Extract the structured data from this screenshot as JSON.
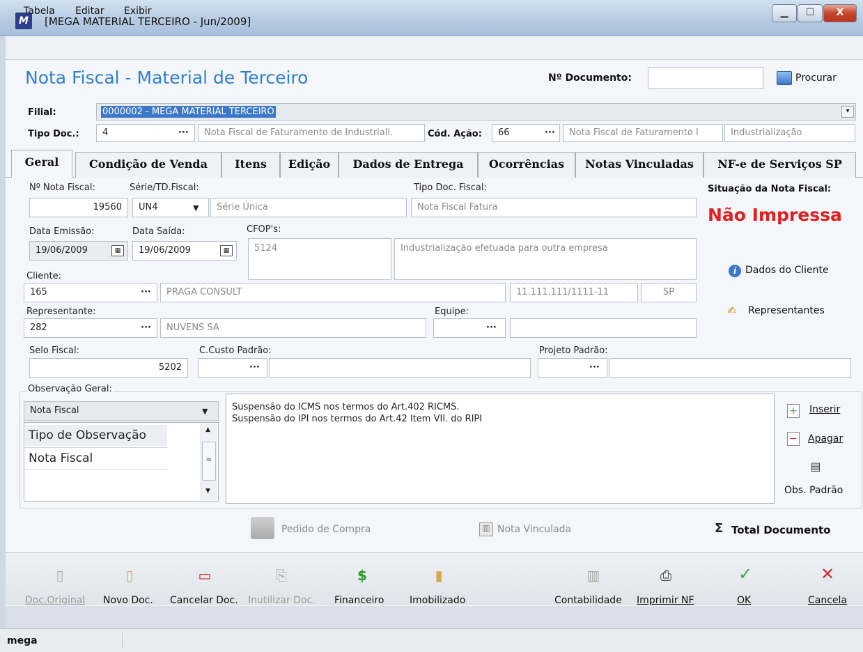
{
  "window": {
    "title": "[MEGA MATERIAL TERCEIRO - Jun/2009]",
    "controls": {
      "minimize": "▁",
      "maximize": "☐",
      "close": "X"
    }
  },
  "menu": [
    "Tabela",
    "Editar",
    "Exibir"
  ],
  "header": {
    "title": "Nota Fiscal - Material de Terceiro",
    "doc_label": "Nº Documento:",
    "doc_value": "",
    "search_label": "Procurar"
  },
  "filial": {
    "label": "Filial:",
    "value": "0000002 - MEGA MATERIAL TERCEIRO"
  },
  "tipo_doc": {
    "label": "Tipo Doc.:",
    "code": "4",
    "desc": "Nota Fiscal de Faturamento de Industriali.",
    "acao_label": "Cód. Ação:",
    "acao_code": "66",
    "acao_desc": "Nota Fiscal de Faturamento I",
    "acao_desc2": "Industrialização"
  },
  "tabs": [
    "Geral",
    "Condição de Venda",
    "Itens",
    "Edição",
    "Dados de Entrega",
    "Ocorrências",
    "Notas Vinculadas",
    "NF-e de Serviços SP"
  ],
  "geral": {
    "nota_label": "Nº Nota Fiscal:",
    "nota_value": "19560",
    "serie_label": "Série/TD.Fiscal:",
    "serie_code": "UN4",
    "serie_desc": "Série Única",
    "tipo_fiscal_label": "Tipo Doc. Fiscal:",
    "tipo_fiscal_value": "Nota Fiscal Fatura",
    "situacao_label": "Situação da Nota Fiscal:",
    "situacao_value": "Não Impressa",
    "emissao_label": "Data Emissão:",
    "emissao_value": "19/06/2009",
    "saida_label": "Data Saída:",
    "saida_value": "19/06/2009",
    "cfop_label": "CFOP's:",
    "cfop_code": "5124",
    "cfop_desc": "Industrialização efetuada para outra empresa",
    "cliente_label": "Cliente:",
    "cliente_code": "165",
    "cliente_name": "PRAGA CONSULT",
    "cliente_doc": "11.111.111/1111-11",
    "cliente_uf": "SP",
    "dados_cliente": "Dados do Cliente",
    "rep_label": "Representante:",
    "rep_code": "282",
    "rep_name": "NUVENS SA",
    "equipe_label": "Equipe:",
    "representantes": "Representantes",
    "selo_label": "Selo Fiscal:",
    "selo_value": "5202",
    "ccusto_label": "C.Custo Padrão:",
    "projeto_label": "Projeto Padrão:",
    "obs_label": "Observação Geral:",
    "obs_combo": "Nota Fiscal",
    "obs_list_header": "Tipo de Observação",
    "obs_list_items": [
      "Nota Fiscal"
    ],
    "obs_text": [
      "Suspensão do ICMS nos termos do Art.402 RICMS.",
      "Suspensão do IPI nos termos do Art.42 Item VIl. do RIPI"
    ],
    "inserir": "Inserir",
    "apagar": "Apagar",
    "obs_padrao": "Obs. Padrão",
    "pedido_compra": "Pedido de Compra",
    "nota_vinculada": "Nota Vinculada",
    "total_documento": "Total Documento"
  },
  "toolbar": {
    "doc_original": "Doc.Original",
    "novo_doc": "Novo Doc.",
    "cancelar_doc": "Cancelar Doc.",
    "inutilizar_doc": "Inutilizar Doc.",
    "financeiro": "Financeiro",
    "imobilizado": "Imobilizado",
    "contabilidade": "Contabilidade",
    "imprimir_nf": "Imprimir NF",
    "ok": "OK",
    "cancela": "Cancela"
  },
  "statusbar": {
    "user": "mega"
  },
  "colors": {
    "accent": "#2f7fcf",
    "status_red": "#e21f1f",
    "ok_green": "#3aa83a",
    "cancel_red": "#d62a2a"
  }
}
